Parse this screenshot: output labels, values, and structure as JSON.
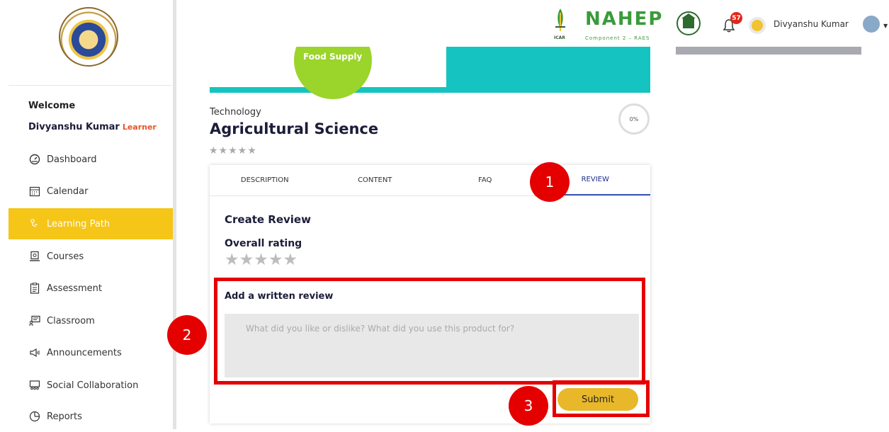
{
  "sidebar": {
    "welcome": "Welcome",
    "user_name": "Divyanshu Kumar",
    "user_role": "Learner",
    "items": [
      {
        "label": "Dashboard",
        "icon": "dashboard-icon"
      },
      {
        "label": "Calendar",
        "icon": "calendar-icon"
      },
      {
        "label": "Learning Path",
        "icon": "learning-path-icon",
        "active": true
      },
      {
        "label": "Courses",
        "icon": "courses-icon"
      },
      {
        "label": "Assessment",
        "icon": "assessment-icon"
      },
      {
        "label": "Classroom",
        "icon": "classroom-icon"
      },
      {
        "label": "Announcements",
        "icon": "announcements-icon"
      },
      {
        "label": "Social Collaboration",
        "icon": "social-collaboration-icon"
      },
      {
        "label": "Reports",
        "icon": "reports-icon"
      }
    ]
  },
  "header": {
    "brand": "NAHEP",
    "brand_sub": "Component 2 – RAES",
    "brand_icar": "ICAR",
    "notification_count": "57",
    "user_name": "Divyanshu Kumar"
  },
  "hero": {
    "label": "Food Supply"
  },
  "course": {
    "category": "Technology",
    "title": "Agricultural Science",
    "progress": "0%",
    "rating_stars": "★★★★★"
  },
  "tabs": [
    {
      "label": "DESCRIPTION"
    },
    {
      "label": "CONTENT"
    },
    {
      "label": "FAQ"
    },
    {
      "label": "REVIEW",
      "active": true
    }
  ],
  "review": {
    "heading": "Create Review",
    "overall_label": "Overall rating",
    "stars": "★★★★★",
    "written_label": "Add a written review",
    "placeholder": "What did you like or dislike? What did you use this product for?",
    "submit_label": "Submit"
  },
  "callouts": [
    "1",
    "2",
    "3"
  ],
  "colors": {
    "accent": "#f5c518",
    "submit": "#e9b82a",
    "highlight": "#e50000",
    "tab_active": "#1d2c8a"
  }
}
